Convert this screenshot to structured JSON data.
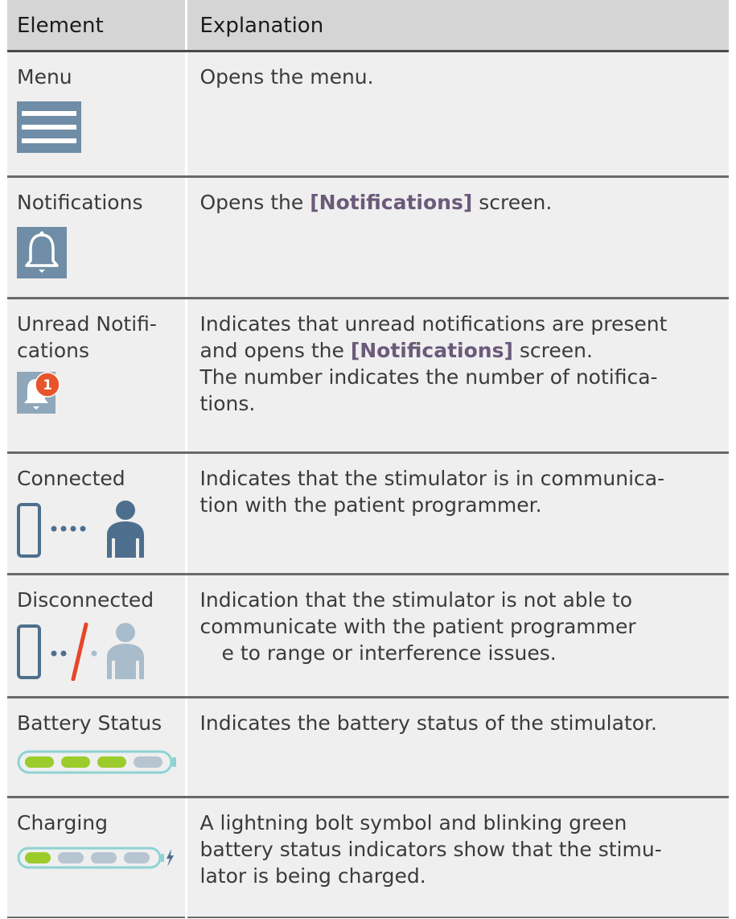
{
  "header": {
    "col1": "Element",
    "col2": "Explanation"
  },
  "rows": [
    {
      "element": [
        "Menu"
      ],
      "icon": "hamburger-menu-icon",
      "explanation": {
        "before": "Opens the menu.",
        "highlight": "",
        "after": ""
      }
    },
    {
      "element": [
        "Notifications"
      ],
      "icon": "bell-icon",
      "explanation": {
        "before": "Opens the ",
        "highlight": "[Notifications]",
        "after": " screen."
      }
    },
    {
      "element": [
        "Unread Notifi-",
        "cations"
      ],
      "icon": "bell-badge-icon",
      "badge_count": "1",
      "explanation": {
        "line1": "Indicates that unread notifications are present",
        "line2_before": "and opens the ",
        "line2_highlight": "[Notifications]",
        "line2_after": " screen.",
        "line3": "The number indicates the number of notifica-",
        "line4": "tions."
      }
    },
    {
      "element": [
        "Connected"
      ],
      "icon": "connected-icon",
      "explanation": {
        "line1": "Indicates that the stimulator is in communica-",
        "line2": "tion with the patient programmer."
      }
    },
    {
      "element": [
        "Disconnected"
      ],
      "icon": "disconnected-icon",
      "explanation": {
        "line1": "Indication that the stimulator is not able to",
        "line2": "communicate with the patient programmer",
        "line3": "e to range or interference issues."
      }
    },
    {
      "element": [
        "Battery Status"
      ],
      "icon": "battery-status-icon",
      "battery_filled": 3,
      "battery_total": 4,
      "explanation": {
        "line1": "Indicates the battery status of the stimulator."
      }
    },
    {
      "element": [
        "Charging"
      ],
      "icon": "charging-battery-icon",
      "battery_filled": 1,
      "battery_total": 4,
      "explanation": {
        "line1": "A lightning bolt symbol and blinking green",
        "line2": "battery status indicators show that the stimu-",
        "line3": "lator is being charged."
      }
    }
  ],
  "colors": {
    "icon_blue": "#4d6f8d",
    "icon_light_blue": "#a9bccb",
    "battery_green": "#9ccc2c",
    "battery_gray": "#b7c5d1",
    "badge_orange": "#e8542b",
    "slash_red": "#e8452a",
    "highlight_text": "#6b5a7a"
  }
}
